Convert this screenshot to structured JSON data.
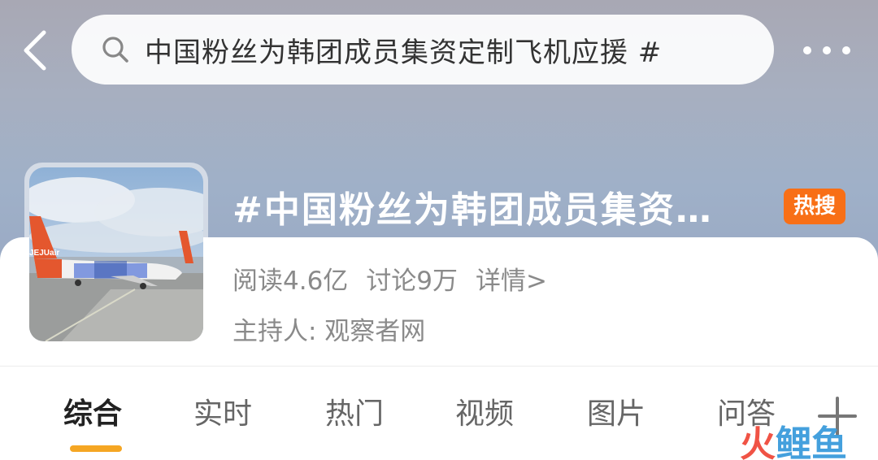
{
  "header": {
    "search_text": "中国粉丝为韩团成员集资定制飞机应援 #"
  },
  "topic": {
    "title": "#中国粉丝为韩团成员集资…",
    "badge": "热搜",
    "reads": "阅读4.6亿",
    "discussions": "讨论9万",
    "detail_link": "详情>",
    "host": "主持人: 观察者网",
    "cover_text": "JEJUair"
  },
  "tabs": [
    {
      "label": "综合",
      "active": true
    },
    {
      "label": "实时",
      "active": false
    },
    {
      "label": "热门",
      "active": false
    },
    {
      "label": "视频",
      "active": false
    },
    {
      "label": "图片",
      "active": false
    },
    {
      "label": "问答",
      "active": false
    }
  ],
  "watermark": {
    "fire": "火",
    "rest": "鲤鱼"
  },
  "colors": {
    "accent": "#f5a623",
    "hot_badge": "#f86f16",
    "secondary_text": "#8a8a8a"
  }
}
